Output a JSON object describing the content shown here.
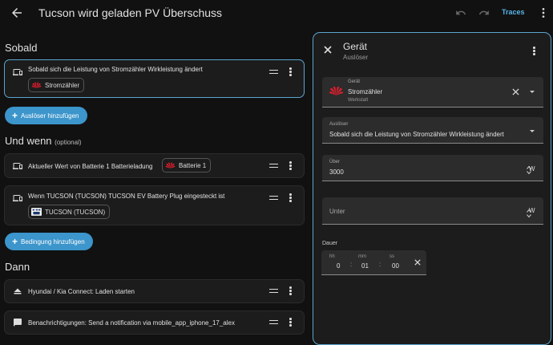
{
  "header": {
    "title": "Tucson wird geladen PV Überschuss",
    "traces_label": "Traces"
  },
  "sections": {
    "triggers": "Sobald",
    "conditions": "Und wenn",
    "conditions_note": "(optional)",
    "actions": "Dann"
  },
  "triggers": [
    {
      "text": "Sobald sich die Leistung von Stromzähler Wirkleistung ändert",
      "chip": "Stromzähler"
    }
  ],
  "add_trigger_label": "Auslöser hinzufügen",
  "conditions": [
    {
      "text": "Aktueller Wert von Batterie 1 Batterieladung",
      "chip": "Batterie 1"
    },
    {
      "text": "Wenn TUCSON (TUCSON) TUCSON EV Battery Plug eingesteckt ist",
      "chip": "TUCSON (TUCSON)"
    }
  ],
  "add_condition_label": "Bedingung hinzufügen",
  "actions": [
    {
      "text": "Hyundai / Kia Connect: Laden starten"
    },
    {
      "text": "Benachrichtigungen: Send a notification via mobile_app_iphone_17_alex"
    }
  ],
  "panel": {
    "title": "Gerät",
    "subtitle": "Auslöser",
    "device": {
      "label": "Gerät",
      "value": "Stromzähler",
      "area": "Werkstatt"
    },
    "trigger": {
      "label": "Auslöser",
      "value": "Sobald sich die Leistung von Stromzähler Wirkleistung ändert"
    },
    "above": {
      "label": "Über",
      "value": "3000",
      "unit": "W"
    },
    "below": {
      "placeholder": "Unter",
      "unit": "W"
    },
    "duration": {
      "label": "Dauer",
      "hh_label": "hh",
      "hh": "0",
      "mm_label": "mm",
      "mm": "01",
      "ss_label": "ss",
      "ss": "00"
    }
  },
  "colors": {
    "accent": "#3c95cb",
    "background": "#111111",
    "card": "#1c1c1c",
    "huawei_red": "#e31d2d"
  }
}
